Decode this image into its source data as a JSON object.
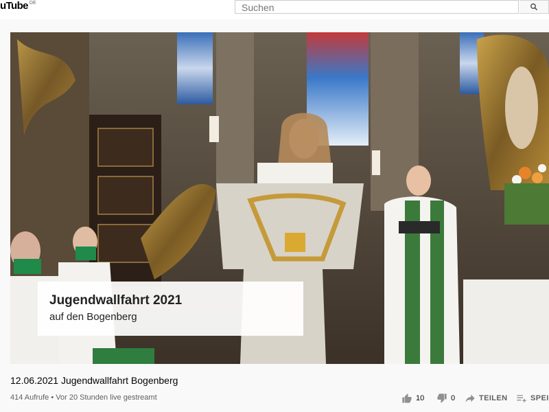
{
  "header": {
    "logo_text": "uTube",
    "logo_country": "DE",
    "search_placeholder": "Suchen"
  },
  "overlay": {
    "title": "Jugendwallfahrt 2021",
    "subtitle": "auf den Bogenberg"
  },
  "video_info": {
    "title": "12.06.2021 Jugendwallfahrt Bogenberg",
    "views": "414 Aufrufe",
    "separator": "•",
    "streamed": "Vor 20 Stunden live gestreamt"
  },
  "actions": {
    "likes": "10",
    "dislikes": "0",
    "share_label": "TEILEN",
    "save_label": "SPEIC"
  }
}
